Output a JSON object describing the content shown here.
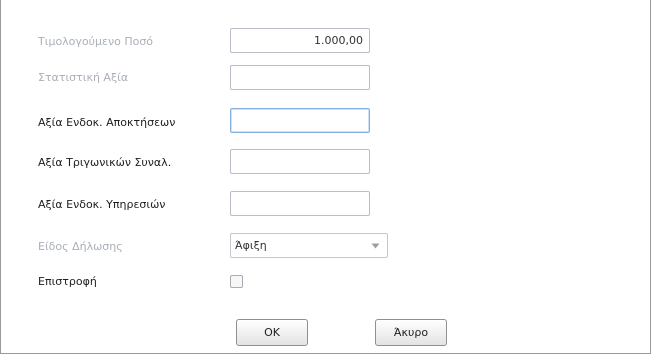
{
  "form": {
    "invoiced_amount": {
      "label": "Τιμολογούμενο Ποσό",
      "value": "1.000,00"
    },
    "statistical_value": {
      "label": "Στατιστική Αξία",
      "value": ""
    },
    "acquisitions_value": {
      "label": "Αξία Ενδοκ. Αποκτήσεων",
      "value": ""
    },
    "triangular_value": {
      "label": "Αξία Τριγωνικών Συναλ.",
      "value": ""
    },
    "services_value": {
      "label": "Αξία Ενδοκ. Υπηρεσιών",
      "value": ""
    },
    "declaration_type": {
      "label": "Είδος Δήλωσης",
      "value": "Άφιξη"
    },
    "refund": {
      "label": "Επιστροφή",
      "checked": false
    }
  },
  "buttons": {
    "ok": "OK",
    "cancel": "Άκυρο"
  },
  "icons": {
    "dropdown": "chevron-down-icon"
  },
  "colors": {
    "disabled_label": "#aab0b8",
    "enabled_label": "#1e1e1e",
    "focus_border": "#86aee0"
  }
}
